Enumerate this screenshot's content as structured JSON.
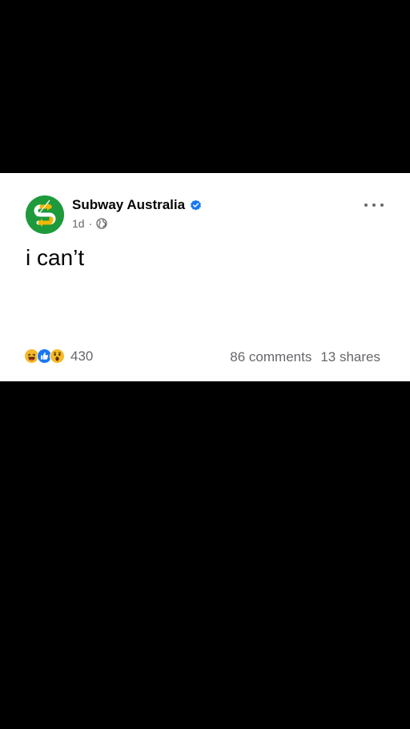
{
  "post": {
    "page_name": "Subway Australia",
    "verified_icon": "verified-badge-icon",
    "time": "1d",
    "separator": "·",
    "audience_icon": "globe-icon",
    "text": "i can’t",
    "more_icon": "more-options-icon"
  },
  "reactions": {
    "icons": [
      "haha-reaction-icon",
      "like-reaction-icon",
      "wow-reaction-icon"
    ],
    "count": "430"
  },
  "engagement": {
    "comments": "86 comments",
    "shares": "13 shares"
  },
  "colors": {
    "background": "#000000",
    "card": "#ffffff",
    "text_primary": "#050505",
    "text_secondary": "#65676b",
    "verified": "#1877f2",
    "avatar_green": "#1e9a3c",
    "subway_yellow": "#f2b700"
  }
}
